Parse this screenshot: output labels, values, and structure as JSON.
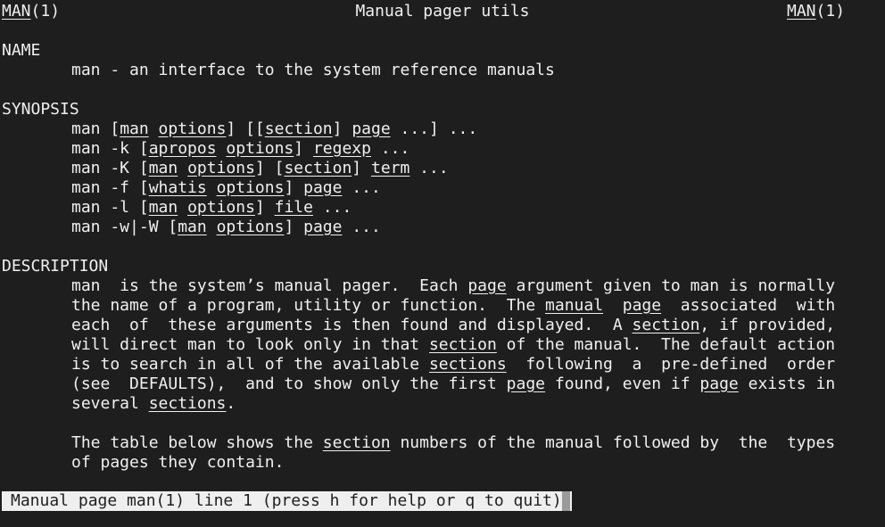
{
  "header": {
    "left_name": "MAN",
    "left_sec": "(1)",
    "center": "Manual pager utils",
    "right_name": "MAN",
    "right_sec": "(1)"
  },
  "sections": {
    "name_heading": "NAME",
    "name_text": "man - an interface to the system reference manuals",
    "synopsis_heading": "SYNOPSIS",
    "description_heading": "DESCRIPTION"
  },
  "synopsis_lines": [
    [
      {
        "t": "man ["
      },
      {
        "t": "man",
        "u": true
      },
      {
        "t": " "
      },
      {
        "t": "options",
        "u": true
      },
      {
        "t": "] [["
      },
      {
        "t": "section",
        "u": true
      },
      {
        "t": "] "
      },
      {
        "t": "page",
        "u": true
      },
      {
        "t": " ...] ..."
      }
    ],
    [
      {
        "t": "man -k ["
      },
      {
        "t": "apropos",
        "u": true
      },
      {
        "t": " "
      },
      {
        "t": "options",
        "u": true
      },
      {
        "t": "] "
      },
      {
        "t": "regexp",
        "u": true
      },
      {
        "t": " ..."
      }
    ],
    [
      {
        "t": "man -K ["
      },
      {
        "t": "man",
        "u": true
      },
      {
        "t": " "
      },
      {
        "t": "options",
        "u": true
      },
      {
        "t": "] ["
      },
      {
        "t": "section",
        "u": true
      },
      {
        "t": "] "
      },
      {
        "t": "term",
        "u": true
      },
      {
        "t": " ..."
      }
    ],
    [
      {
        "t": "man -f ["
      },
      {
        "t": "whatis",
        "u": true
      },
      {
        "t": " "
      },
      {
        "t": "options",
        "u": true
      },
      {
        "t": "] "
      },
      {
        "t": "page",
        "u": true
      },
      {
        "t": " ..."
      }
    ],
    [
      {
        "t": "man -l ["
      },
      {
        "t": "man",
        "u": true
      },
      {
        "t": " "
      },
      {
        "t": "options",
        "u": true
      },
      {
        "t": "] "
      },
      {
        "t": "file",
        "u": true
      },
      {
        "t": " ..."
      }
    ],
    [
      {
        "t": "man -w|-W ["
      },
      {
        "t": "man",
        "u": true
      },
      {
        "t": " "
      },
      {
        "t": "options",
        "u": true
      },
      {
        "t": "] "
      },
      {
        "t": "page",
        "u": true
      },
      {
        "t": " ..."
      }
    ]
  ],
  "description_lines": [
    [
      {
        "t": "man  is the system’s manual pager.  Each "
      },
      {
        "t": "page",
        "u": true
      },
      {
        "t": " argument given to man is normally"
      }
    ],
    [
      {
        "t": "the name of a program, utility or function.  The "
      },
      {
        "t": "manual",
        "u": true
      },
      {
        "t": "  "
      },
      {
        "t": "page",
        "u": true
      },
      {
        "t": "  associated  with"
      }
    ],
    [
      {
        "t": "each  of  these arguments is then found and displayed.  A "
      },
      {
        "t": "section",
        "u": true
      },
      {
        "t": ", if provided,"
      }
    ],
    [
      {
        "t": "will direct man to look only in that "
      },
      {
        "t": "section",
        "u": true
      },
      {
        "t": " of the manual.  The default action"
      }
    ],
    [
      {
        "t": "is to search in all of the available "
      },
      {
        "t": "sections",
        "u": true
      },
      {
        "t": "  following  a  pre-defined  order"
      }
    ],
    [
      {
        "t": "(see  DEFAULTS),  and to show only the first "
      },
      {
        "t": "page",
        "u": true
      },
      {
        "t": " found, even if "
      },
      {
        "t": "page",
        "u": true
      },
      {
        "t": " exists in"
      }
    ],
    [
      {
        "t": "several "
      },
      {
        "t": "sections",
        "u": true
      },
      {
        "t": "."
      }
    ]
  ],
  "description2_lines": [
    [
      {
        "t": "The table below shows the "
      },
      {
        "t": "section",
        "u": true
      },
      {
        "t": " numbers of the manual followed by  the  types"
      }
    ],
    [
      {
        "t": "of pages they contain."
      }
    ]
  ],
  "status": {
    "text": "Manual page man(1) line 1 (press h for help or q to quit)"
  },
  "colors": {
    "background": "#1e1e1e",
    "foreground": "#f0f0f0",
    "status_bg": "#efefef",
    "cursor": "#9a9a9a"
  }
}
